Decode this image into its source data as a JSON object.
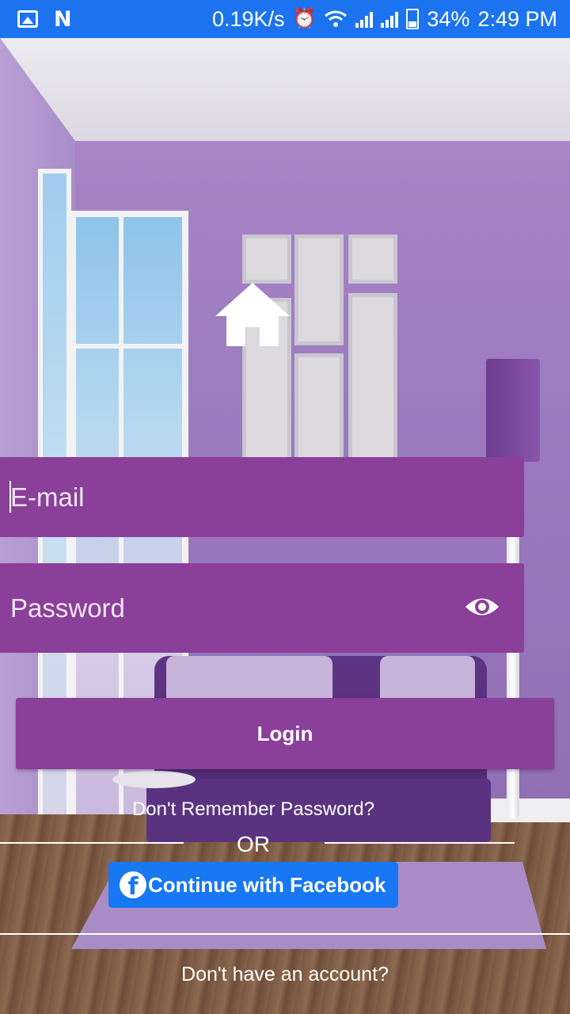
{
  "status_bar": {
    "left_icons": [
      "image-notification-icon",
      "n-notification-icon"
    ],
    "network_speed": "0.19K/s",
    "battery_percent": "34%",
    "time": "2:49 PM",
    "right_icons": [
      "alarm-icon",
      "wifi-icon",
      "signal-icon",
      "signal-icon",
      "battery-icon"
    ],
    "color": "#1b73f0"
  },
  "logo": {
    "icon": "home-icon"
  },
  "form": {
    "email_placeholder": "E-mail",
    "password_placeholder": "Password",
    "password_toggle_icon": "eye-icon",
    "login_label": "Login",
    "forgot_password": "Don't Remember Password?",
    "separator": "OR",
    "facebook_label": "Continue with Facebook",
    "signup_prompt": "Don't have an account?"
  },
  "colors": {
    "field_background": "#8a3f98",
    "facebook_blue": "#1877f2",
    "text": "#ffffff"
  }
}
